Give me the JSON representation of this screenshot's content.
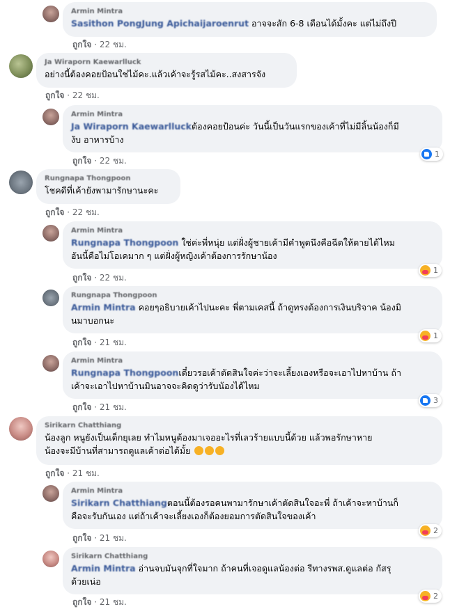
{
  "comments": [
    {
      "author": "Armin Mintra",
      "mention": "Sasithon PongJung Apichaijaroenrut",
      "text": "อาจจะสัก 6-8 เดือนได้มั้งคะ แต่ไม่ถึงปี",
      "like": "ถูกใจ",
      "time": "22 ชม.",
      "reactions": ""
    },
    {
      "author": "Ja Wiraporn Kaewarlluck",
      "mention": "",
      "text": "อย่างนี้ต้องคอยป้อนใช่ไม้คะ.แล้วเค้าจะรู้รสไม้คะ..สงสารจัง",
      "like": "ถูกใจ",
      "time": "22 ชม.",
      "reactions": ""
    },
    {
      "author": "Armin Mintra",
      "mention": "Ja Wiraporn Kaewarlluck",
      "text": "ต้องคอยป้อนค่ะ วันนี้เป็นวันแรกของเค้าที่ไม่มีลิ้นน้องก็มี",
      "text2": "งับ อาหารบ้าง",
      "like": "ถูกใจ",
      "time": "22 ชม.",
      "reactions": "1"
    },
    {
      "author": "Rungnapa Thongpoon",
      "mention": "",
      "text": "โชคดีที่เค้ายังพามารักษานะคะ",
      "like": "ถูกใจ",
      "time": "22 ชม.",
      "reactions": ""
    },
    {
      "author": "Armin Mintra",
      "mention": "Rungnapa Thongpoon",
      "text": "ใช่ค่ะพี่หนุ่ย แต่ฝั่งผู้ชายเค้ามีคำพูดนึงคือฉีดให้ตายได้ไหม",
      "text2": "อันนี้คือไม่โอเคมาก ๆ แต่ฝั่งผู้หญิงเค้าต้องการรักษาน้อง",
      "like": "ถูกใจ",
      "time": "22 ชม.",
      "reactions": "1"
    },
    {
      "author": "Rungnapa Thongpoon",
      "mention": "Armin Mintra",
      "text": "คอยๆอธิบายเค้าไปนะคะ พี่ตามเคสนี้ ถ้าดูทรงต้องการเงินบริจาค น้องมิ",
      "text2": "นมาบอกนะ",
      "like": "ถูกใจ",
      "time": "21 ชม.",
      "reactions": "1"
    },
    {
      "author": "Armin Mintra",
      "mention": "Rungnapa Thongpoon",
      "text": "เดี๋ยวรอเค้าตัดสินใจค่ะว่าจะเลี้ยงเองหรือจะเอาไปหาบ้าน ถ้า",
      "text2": "เค้าจะเอาไปหาบ้านมินอาจจะคิดดูว่ารับน้องได้ไหม",
      "like": "ถูกใจ",
      "time": "21 ชม.",
      "reactions": "3"
    },
    {
      "author": "Sirikarn Chatthiang",
      "mention": "",
      "text": "น้องลูก หนูยังเป็นเด็กยุเลย ทำไมหนูต้องมาเจออะไรที่เลวร้ายแบบนี้ด้วย แล้วพอรักษาหาย",
      "text2": "น้องจะมีบ้านที่สามารถดูแลเค้าต่อได้มั้ย",
      "like": "ถูกใจ",
      "time": "21 ชม.",
      "reactions": ""
    },
    {
      "author": "Armin Mintra",
      "mention": "Sirikarn Chatthiang",
      "text": "ตอนนี้ต้องรอคนพามารักษาเค้าตัดสินใจอะพี่ ถ้าเค้าจะหาบ้านก็",
      "text2": "คือจะรับกันเอง แต่ถ้าเค้าจะเลี้ยงเองก็ต้องยอมการตัดสินใจของเค้า",
      "like": "ถูกใจ",
      "time": "21 ชม.",
      "reactions": "2"
    },
    {
      "author": "Sirikarn Chatthiang",
      "mention": "Armin Mintra",
      "text": "อ่านจบมันจุกที่ใจมาก ถ้าคนที่เจอดูแลน้องต่อ รีทางรพส.ดูแลต่อ กัสรุ",
      "text2": "ด้วยเน่อ",
      "like": "ถูกใจ",
      "time": "21 ชม.",
      "reactions": "2"
    }
  ],
  "separator": "·",
  "colors": {
    "bubble": "#f0f2f5",
    "meta": "#65676b",
    "like": "#1877f2",
    "care": "#f7b125"
  }
}
